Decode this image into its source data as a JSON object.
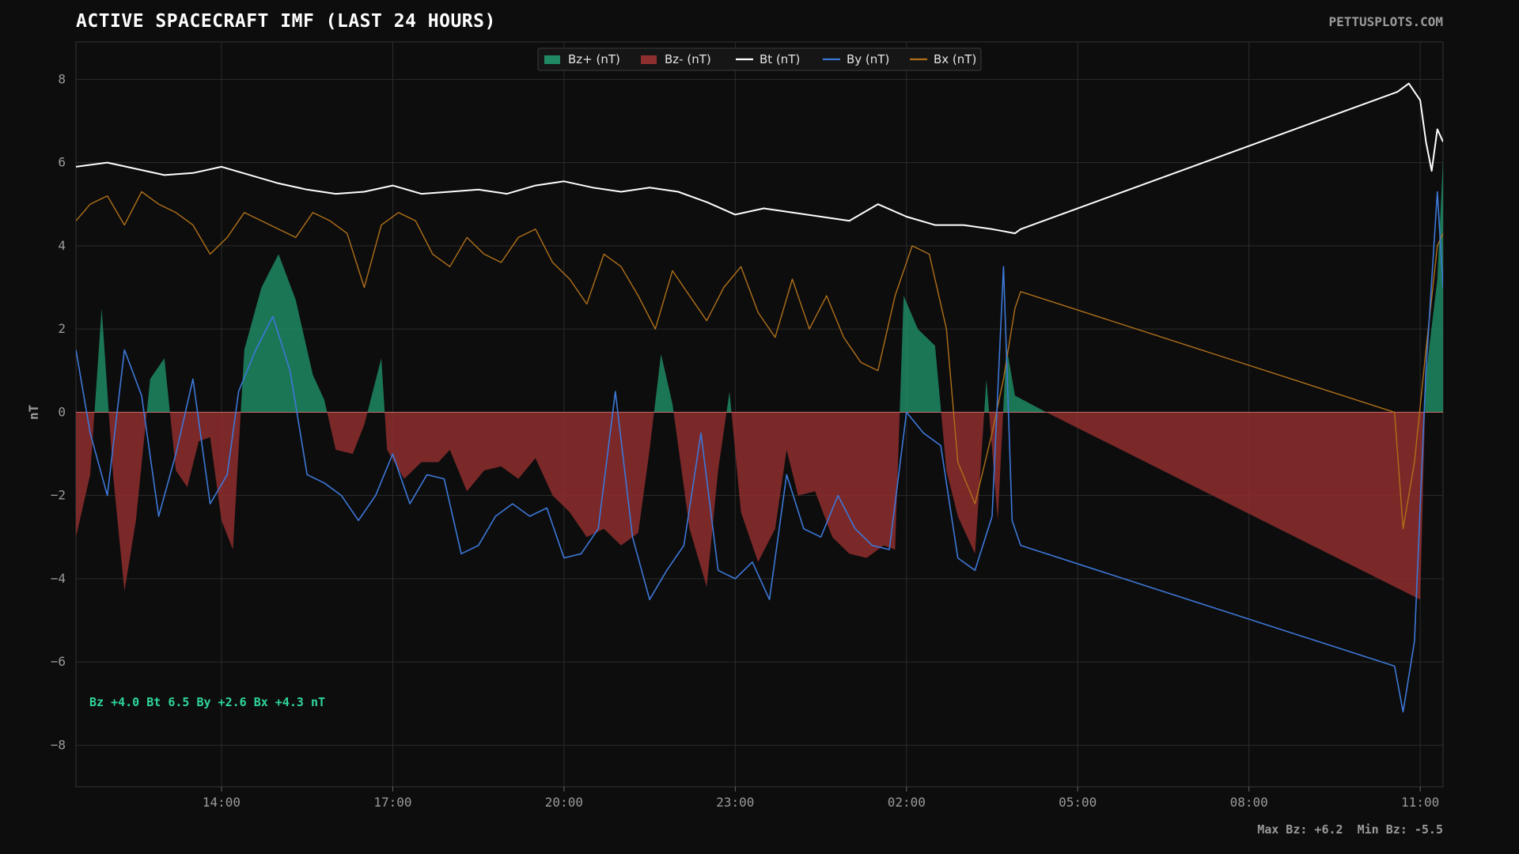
{
  "header": {
    "title": "ACTIVE SPACECRAFT IMF (LAST 24 HOURS)",
    "brand": "PETTUSPLOTS.COM"
  },
  "footer": {
    "stats": "Max Bz: +6.2  Min Bz: -5.5"
  },
  "colors": {
    "background": "#0d0d0d",
    "bz_pos": "#1f8a64",
    "bz_neg": "#8f2e2e",
    "bt": "#ffffff",
    "by": "#3d78d8",
    "bx": "#b0701a",
    "grid": "#2c2c2c"
  },
  "chart_data": {
    "type": "line",
    "title": "ACTIVE SPACECRAFT IMF (LAST 24 HOURS)",
    "xlabel": "",
    "ylabel": "nT",
    "ylim": [
      -9,
      8.9
    ],
    "xlim_hours": [
      11.45,
      35.4
    ],
    "x_unit": "hours (clock time; values above 24 are the next day)",
    "yticks": [
      8,
      6,
      4,
      2,
      0,
      -2,
      -4,
      -6,
      -8
    ],
    "ytick_labels": [
      "8",
      "6",
      "4",
      "2",
      "0",
      "−2",
      "−4",
      "−6",
      "−8"
    ],
    "xticks": [
      14,
      17,
      20,
      23,
      26,
      29,
      32,
      35
    ],
    "xtick_labels": [
      "14:00",
      "17:00",
      "20:00",
      "23:00",
      "02:00",
      "05:00",
      "08:00",
      "11:00"
    ],
    "grid": true,
    "legend_position": "top-center",
    "legend": [
      "Bz+ (nT)",
      "Bz- (nT)",
      "Bt (nT)",
      "By (nT)",
      "Bx (nT)"
    ],
    "readout": "Bz +4.0  Bt 6.5  By +2.6  Bx +4.3 nT",
    "series": [
      {
        "name": "Bz",
        "fill": "split at zero: Bz+ green above, Bz- red below",
        "points": [
          [
            11.45,
            -3.0
          ],
          [
            11.7,
            -1.5
          ],
          [
            11.9,
            2.5
          ],
          [
            12.1,
            -1.5
          ],
          [
            12.3,
            -4.3
          ],
          [
            12.5,
            -2.6
          ],
          [
            12.75,
            0.8
          ],
          [
            13.0,
            1.3
          ],
          [
            13.2,
            -1.4
          ],
          [
            13.4,
            -1.8
          ],
          [
            13.6,
            -0.7
          ],
          [
            13.8,
            -0.6
          ],
          [
            14.0,
            -2.6
          ],
          [
            14.2,
            -3.3
          ],
          [
            14.4,
            1.5
          ],
          [
            14.7,
            3.0
          ],
          [
            15.0,
            3.8
          ],
          [
            15.3,
            2.7
          ],
          [
            15.6,
            0.9
          ],
          [
            15.8,
            0.3
          ],
          [
            16.0,
            -0.9
          ],
          [
            16.3,
            -1.0
          ],
          [
            16.5,
            -0.3
          ],
          [
            16.8,
            1.3
          ],
          [
            16.9,
            -0.9
          ],
          [
            17.2,
            -1.6
          ],
          [
            17.5,
            -1.2
          ],
          [
            17.8,
            -1.2
          ],
          [
            18.0,
            -0.9
          ],
          [
            18.3,
            -1.9
          ],
          [
            18.6,
            -1.4
          ],
          [
            18.9,
            -1.3
          ],
          [
            19.2,
            -1.6
          ],
          [
            19.5,
            -1.1
          ],
          [
            19.8,
            -2.0
          ],
          [
            20.1,
            -2.4
          ],
          [
            20.4,
            -3.0
          ],
          [
            20.7,
            -2.8
          ],
          [
            21.0,
            -3.2
          ],
          [
            21.3,
            -2.9
          ],
          [
            21.5,
            -0.9
          ],
          [
            21.7,
            1.4
          ],
          [
            21.9,
            0.2
          ],
          [
            22.2,
            -2.8
          ],
          [
            22.5,
            -4.2
          ],
          [
            22.7,
            -1.4
          ],
          [
            22.9,
            0.5
          ],
          [
            23.1,
            -2.4
          ],
          [
            23.4,
            -3.6
          ],
          [
            23.7,
            -2.8
          ],
          [
            23.9,
            -0.9
          ],
          [
            24.1,
            -2.0
          ],
          [
            24.4,
            -1.9
          ],
          [
            24.7,
            -3.0
          ],
          [
            25.0,
            -3.4
          ],
          [
            25.3,
            -3.5
          ],
          [
            25.6,
            -3.2
          ],
          [
            25.8,
            -3.3
          ],
          [
            25.95,
            2.8
          ],
          [
            26.2,
            2.0
          ],
          [
            26.5,
            1.6
          ],
          [
            26.7,
            -1.4
          ],
          [
            26.9,
            -2.5
          ],
          [
            27.2,
            -3.4
          ],
          [
            27.4,
            0.8
          ],
          [
            27.6,
            -2.6
          ],
          [
            27.75,
            1.6
          ],
          [
            27.9,
            0.4
          ],
          [
            28.45,
            0.0
          ],
          [
            35.0,
            -4.5
          ],
          [
            35.1,
            0.9
          ],
          [
            35.3,
            3.2
          ],
          [
            35.4,
            6.1
          ]
        ]
      },
      {
        "name": "Bt",
        "points": [
          [
            11.45,
            5.9
          ],
          [
            12.0,
            6.0
          ],
          [
            12.5,
            5.85
          ],
          [
            13.0,
            5.7
          ],
          [
            13.5,
            5.75
          ],
          [
            14.0,
            5.9
          ],
          [
            14.5,
            5.7
          ],
          [
            15.0,
            5.5
          ],
          [
            15.5,
            5.35
          ],
          [
            16.0,
            5.25
          ],
          [
            16.5,
            5.3
          ],
          [
            17.0,
            5.45
          ],
          [
            17.5,
            5.25
          ],
          [
            18.0,
            5.3
          ],
          [
            18.5,
            5.35
          ],
          [
            19.0,
            5.25
          ],
          [
            19.5,
            5.45
          ],
          [
            20.0,
            5.55
          ],
          [
            20.5,
            5.4
          ],
          [
            21.0,
            5.3
          ],
          [
            21.5,
            5.4
          ],
          [
            22.0,
            5.3
          ],
          [
            22.5,
            5.05
          ],
          [
            23.0,
            4.75
          ],
          [
            23.5,
            4.9
          ],
          [
            24.0,
            4.8
          ],
          [
            24.5,
            4.7
          ],
          [
            25.0,
            4.6
          ],
          [
            25.5,
            5.0
          ],
          [
            26.0,
            4.7
          ],
          [
            26.5,
            4.5
          ],
          [
            27.0,
            4.5
          ],
          [
            27.5,
            4.4
          ],
          [
            27.9,
            4.3
          ],
          [
            28.0,
            4.4
          ],
          [
            34.6,
            7.7
          ],
          [
            34.8,
            7.9
          ],
          [
            35.0,
            7.5
          ],
          [
            35.1,
            6.5
          ],
          [
            35.2,
            5.8
          ],
          [
            35.3,
            6.8
          ],
          [
            35.4,
            6.5
          ]
        ]
      },
      {
        "name": "By",
        "points": [
          [
            11.45,
            1.5
          ],
          [
            11.7,
            -0.5
          ],
          [
            12.0,
            -2.0
          ],
          [
            12.3,
            1.5
          ],
          [
            12.6,
            0.4
          ],
          [
            12.9,
            -2.5
          ],
          [
            13.2,
            -1.0
          ],
          [
            13.5,
            0.8
          ],
          [
            13.8,
            -2.2
          ],
          [
            14.1,
            -1.5
          ],
          [
            14.3,
            0.5
          ],
          [
            14.6,
            1.5
          ],
          [
            14.9,
            2.3
          ],
          [
            15.2,
            1.0
          ],
          [
            15.5,
            -1.5
          ],
          [
            15.8,
            -1.7
          ],
          [
            16.1,
            -2.0
          ],
          [
            16.4,
            -2.6
          ],
          [
            16.7,
            -2.0
          ],
          [
            17.0,
            -1.0
          ],
          [
            17.3,
            -2.2
          ],
          [
            17.6,
            -1.5
          ],
          [
            17.9,
            -1.6
          ],
          [
            18.2,
            -3.4
          ],
          [
            18.5,
            -3.2
          ],
          [
            18.8,
            -2.5
          ],
          [
            19.1,
            -2.2
          ],
          [
            19.4,
            -2.5
          ],
          [
            19.7,
            -2.3
          ],
          [
            20.0,
            -3.5
          ],
          [
            20.3,
            -3.4
          ],
          [
            20.6,
            -2.8
          ],
          [
            20.9,
            0.5
          ],
          [
            21.2,
            -3.0
          ],
          [
            21.5,
            -4.5
          ],
          [
            21.8,
            -3.8
          ],
          [
            22.1,
            -3.2
          ],
          [
            22.4,
            -0.5
          ],
          [
            22.7,
            -3.8
          ],
          [
            23.0,
            -4.0
          ],
          [
            23.3,
            -3.6
          ],
          [
            23.6,
            -4.5
          ],
          [
            23.9,
            -1.5
          ],
          [
            24.2,
            -2.8
          ],
          [
            24.5,
            -3.0
          ],
          [
            24.8,
            -2.0
          ],
          [
            25.1,
            -2.8
          ],
          [
            25.4,
            -3.2
          ],
          [
            25.7,
            -3.3
          ],
          [
            26.0,
            0.0
          ],
          [
            26.3,
            -0.5
          ],
          [
            26.6,
            -0.8
          ],
          [
            26.9,
            -3.5
          ],
          [
            27.2,
            -3.8
          ],
          [
            27.5,
            -2.5
          ],
          [
            27.7,
            3.5
          ],
          [
            27.85,
            -2.6
          ],
          [
            28.0,
            -3.2
          ],
          [
            34.55,
            -6.1
          ],
          [
            34.7,
            -7.2
          ],
          [
            34.9,
            -5.5
          ],
          [
            35.1,
            1.0
          ],
          [
            35.3,
            5.3
          ],
          [
            35.4,
            3.0
          ]
        ]
      },
      {
        "name": "Bx",
        "points": [
          [
            11.45,
            4.6
          ],
          [
            11.7,
            5.0
          ],
          [
            12.0,
            5.2
          ],
          [
            12.3,
            4.5
          ],
          [
            12.6,
            5.3
          ],
          [
            12.9,
            5.0
          ],
          [
            13.2,
            4.8
          ],
          [
            13.5,
            4.5
          ],
          [
            13.8,
            3.8
          ],
          [
            14.1,
            4.2
          ],
          [
            14.4,
            4.8
          ],
          [
            14.7,
            4.6
          ],
          [
            15.0,
            4.4
          ],
          [
            15.3,
            4.2
          ],
          [
            15.6,
            4.8
          ],
          [
            15.9,
            4.6
          ],
          [
            16.2,
            4.3
          ],
          [
            16.5,
            3.0
          ],
          [
            16.8,
            4.5
          ],
          [
            17.1,
            4.8
          ],
          [
            17.4,
            4.6
          ],
          [
            17.7,
            3.8
          ],
          [
            18.0,
            3.5
          ],
          [
            18.3,
            4.2
          ],
          [
            18.6,
            3.8
          ],
          [
            18.9,
            3.6
          ],
          [
            19.2,
            4.2
          ],
          [
            19.5,
            4.4
          ],
          [
            19.8,
            3.6
          ],
          [
            20.1,
            3.2
          ],
          [
            20.4,
            2.6
          ],
          [
            20.7,
            3.8
          ],
          [
            21.0,
            3.5
          ],
          [
            21.3,
            2.8
          ],
          [
            21.6,
            2.0
          ],
          [
            21.9,
            3.4
          ],
          [
            22.2,
            2.8
          ],
          [
            22.5,
            2.2
          ],
          [
            22.8,
            3.0
          ],
          [
            23.1,
            3.5
          ],
          [
            23.4,
            2.4
          ],
          [
            23.7,
            1.8
          ],
          [
            24.0,
            3.2
          ],
          [
            24.3,
            2.0
          ],
          [
            24.6,
            2.8
          ],
          [
            24.9,
            1.8
          ],
          [
            25.2,
            1.2
          ],
          [
            25.5,
            1.0
          ],
          [
            25.8,
            2.8
          ],
          [
            26.1,
            4.0
          ],
          [
            26.4,
            3.8
          ],
          [
            26.7,
            2.0
          ],
          [
            26.9,
            -1.2
          ],
          [
            27.2,
            -2.2
          ],
          [
            27.5,
            -0.5
          ],
          [
            27.7,
            0.8
          ],
          [
            27.9,
            2.5
          ],
          [
            28.0,
            2.9
          ],
          [
            34.55,
            0.0
          ],
          [
            34.7,
            -2.8
          ],
          [
            34.9,
            -1.2
          ],
          [
            35.1,
            1.5
          ],
          [
            35.3,
            4.0
          ],
          [
            35.4,
            4.3
          ]
        ]
      }
    ]
  }
}
